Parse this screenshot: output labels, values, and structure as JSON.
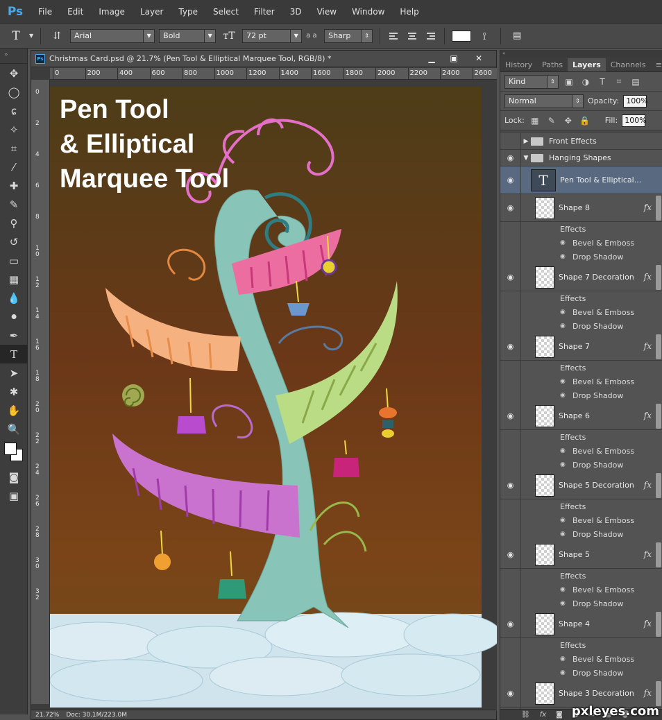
{
  "app": {
    "logo": "Ps"
  },
  "menu": [
    "File",
    "Edit",
    "Image",
    "Layer",
    "Type",
    "Select",
    "Filter",
    "3D",
    "View",
    "Window",
    "Help"
  ],
  "options": {
    "font_family": "Arial",
    "font_style": "Bold",
    "font_size": "72 pt",
    "antialias_label": "a a",
    "antialias": "Sharp",
    "text_color": "#ffffff"
  },
  "document": {
    "title": "Christmas Card.psd @ 21.7% (Pen Tool & Elliptical Marquee Tool, RGB/8) *",
    "ruler_top": [
      "0",
      "200",
      "400",
      "600",
      "800",
      "1000",
      "1200",
      "1400",
      "1600",
      "1800",
      "2000",
      "2200",
      "2400",
      "2600"
    ],
    "ruler_left": [
      "0",
      "2",
      "4",
      "6",
      "8",
      "1 0",
      "1 2",
      "1 4",
      "1 6",
      "1 8",
      "2 0",
      "2 2",
      "2 4",
      "2 6",
      "2 8",
      "3 0",
      "3 2"
    ],
    "zoom": "21.72%",
    "doc_size": "Doc: 30.1M/223.0M",
    "heading_line1": "Pen Tool",
    "heading_line2": "& Elliptical",
    "heading_line3": "Marquee Tool"
  },
  "panels": {
    "tabs": [
      "History",
      "Paths",
      "Layers",
      "Channels"
    ],
    "active_tab": "Layers",
    "filter_kind": "Kind",
    "blend_mode": "Normal",
    "opacity_label": "Opacity:",
    "opacity": "100%",
    "lock_label": "Lock:",
    "fill_label": "Fill:",
    "fill": "100%",
    "groups": [
      {
        "name": "Front Effects"
      },
      {
        "name": "Hanging Shapes"
      }
    ],
    "text_layer": "Pen Tool & Elliptical...",
    "effects_label": "Effects",
    "effect_bevel": "Bevel & Emboss",
    "effect_shadow": "Drop Shadow",
    "layers": [
      {
        "name": "Shape 8"
      },
      {
        "name": "Shape 7 Decoration"
      },
      {
        "name": "Shape 7"
      },
      {
        "name": "Shape 6"
      },
      {
        "name": "Shape 5 Decoration"
      },
      {
        "name": "Shape 5"
      },
      {
        "name": "Shape 4"
      },
      {
        "name": "Shape 3 Decoration"
      }
    ]
  },
  "watermark": "pxleyes.com"
}
